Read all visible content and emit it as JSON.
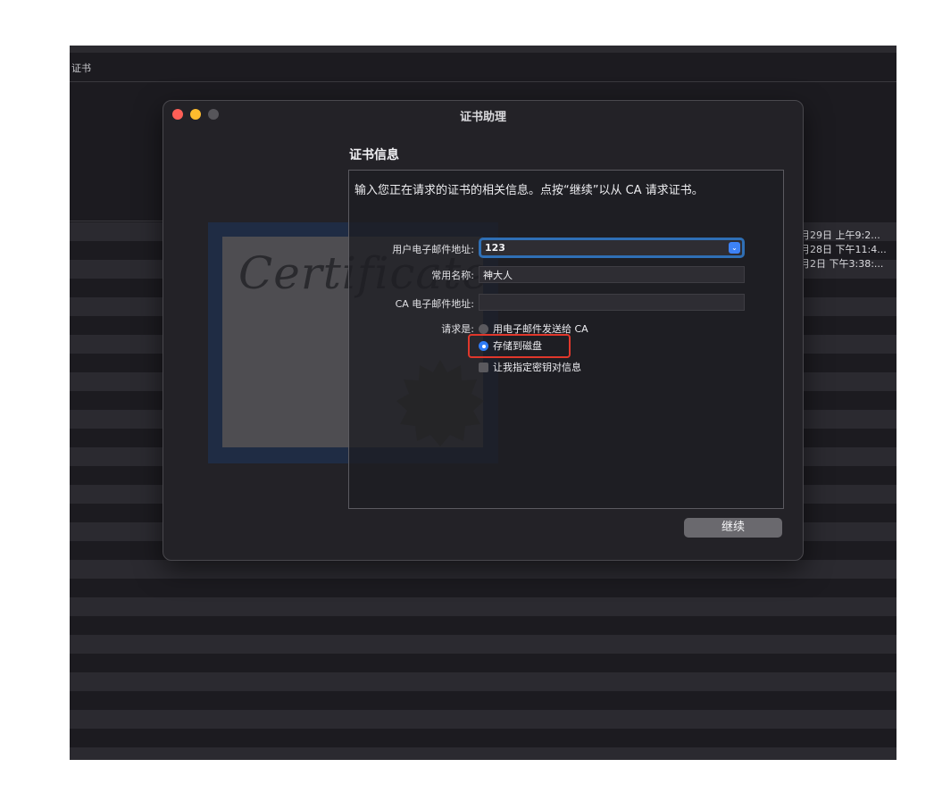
{
  "background": {
    "window_label": "证书",
    "dates": [
      "月29日 上午9:2...",
      "月28日 下午11:4...",
      "月2日 下午3:38:..."
    ]
  },
  "dialog": {
    "title": "证书助理",
    "traffic_lights": {
      "close_color": "#fe5f57",
      "minimize_color": "#febc2e",
      "zoom_color": "#56555a"
    },
    "illustration_text": "Certificate",
    "heading": "证书信息",
    "intro": "输入您正在请求的证书的相关信息。点按“继续”以从 CA 请求证书。",
    "fields": {
      "email_label": "用户电子邮件地址:",
      "email_value": "123",
      "common_name_label": "常用名称:",
      "common_name_value": "神大人",
      "ca_email_label": "CA 电子邮件地址:",
      "ca_email_value": ""
    },
    "request": {
      "label": "请求是:",
      "option_email": "用电子邮件发送给 CA",
      "option_disk": "存储到磁盘",
      "selected": "存储到磁盘",
      "checkbox_label": "让我指定密钥对信息",
      "checkbox_checked": false
    },
    "continue_label": "继续",
    "highlight_color": "#e0372b"
  }
}
